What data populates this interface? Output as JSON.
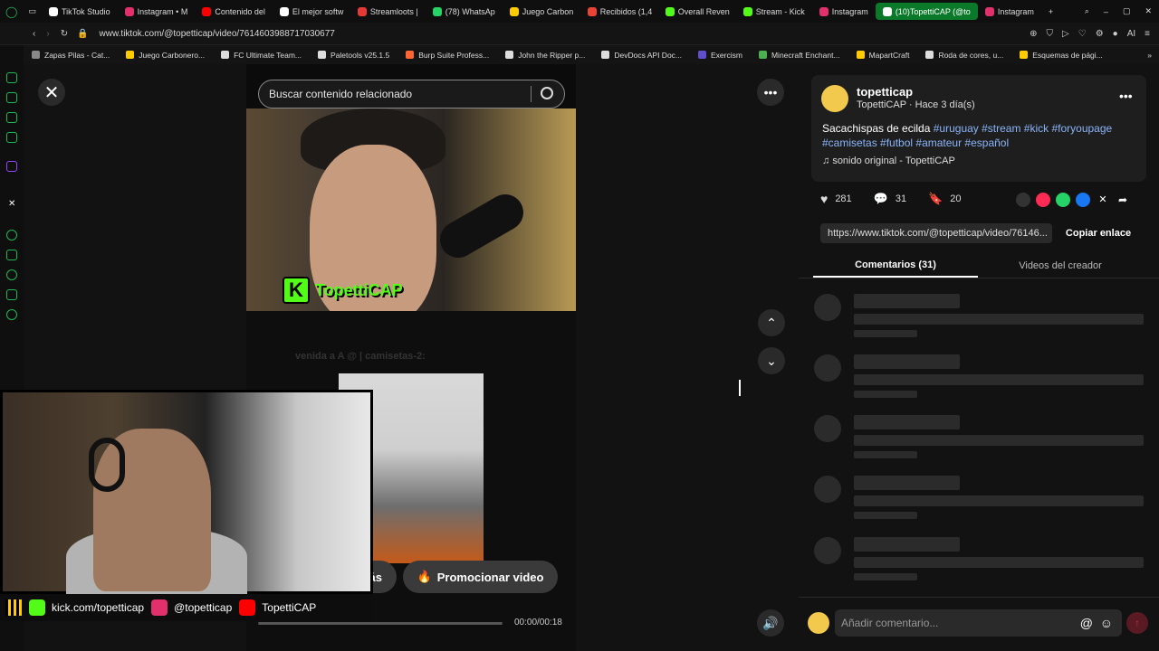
{
  "browser": {
    "tabs": [
      {
        "label": "TikTok Studio",
        "color": "#ffffff"
      },
      {
        "label": "Instagram • M",
        "color": "#e1306c"
      },
      {
        "label": "Contenido del",
        "color": "#ff0000"
      },
      {
        "label": "El mejor softw",
        "color": "#ffffff"
      },
      {
        "label": "Streamloots |",
        "color": "#e53935"
      },
      {
        "label": "(78) WhatsAp",
        "color": "#25d366"
      },
      {
        "label": "Juego Carbon",
        "color": "#ffcc00"
      },
      {
        "label": "Recibidos (1,4",
        "color": "#ea4335"
      },
      {
        "label": "Overall Reven",
        "color": "#53fc18"
      },
      {
        "label": "Stream - Kick",
        "color": "#53fc18"
      },
      {
        "label": "Instagram",
        "color": "#e1306c"
      },
      {
        "label": "(10)TopettiCAP (@to",
        "color": "#ffffff",
        "active": true
      },
      {
        "label": "Instagram",
        "color": "#e1306c"
      }
    ],
    "url": "www.tiktok.com/@topetticap/video/7614603988717030677",
    "ai_label": "AI",
    "bookmarks": [
      {
        "label": "Zapas Pilas - Cat...",
        "color": "#888888"
      },
      {
        "label": "Juego Carbonero...",
        "color": "#ffcc00"
      },
      {
        "label": "FC Ultimate Team...",
        "color": "#dddddd"
      },
      {
        "label": "Paletools v25.1.5",
        "color": "#dddddd"
      },
      {
        "label": "Burp Suite Profess...",
        "color": "#ff6633"
      },
      {
        "label": "John the Ripper p...",
        "color": "#dddddd"
      },
      {
        "label": "DevDocs API Doc...",
        "color": "#dddddd"
      },
      {
        "label": "Exercism",
        "color": "#604fcd"
      },
      {
        "label": "Minecraft Enchant...",
        "color": "#4caf50"
      },
      {
        "label": "MapartCraft",
        "color": "#ffcc00"
      },
      {
        "label": "Roda de cores, u...",
        "color": "#dddddd"
      },
      {
        "label": "Esquemas de pági...",
        "color": "#ffcc00"
      }
    ]
  },
  "video": {
    "search_placeholder": "Buscar contenido relacionado",
    "stream_logo_text": "TopettiCAP",
    "kick_letter": "K",
    "more_button": "más",
    "promote_button": "Promocionar video",
    "time": "00:00/00:18",
    "overlay_caption": "venida a A @ | camisetas-2:"
  },
  "stream_overlay": {
    "socials": [
      {
        "label": "kick.com/topetticap",
        "color": "#53fc18"
      },
      {
        "label": "@topetticap",
        "color": "#e1306c"
      },
      {
        "label": "TopettiCAP",
        "color": "#ff0000"
      }
    ]
  },
  "post": {
    "username": "topetticap",
    "meta": "TopettiCAP · Hace 3 día(s)",
    "desc_text": "Sacachispas de ecilda ",
    "hashtags_line1": "#uruguay #stream #kick #foryoupage",
    "hashtags_line2": "#camisetas #futbol #amateur #español",
    "sound": "sonido original - TopettiCAP",
    "likes": "281",
    "comments": "31",
    "saves": "20",
    "link": "https://www.tiktok.com/@topetticap/video/76146...",
    "copy_link": "Copiar enlace",
    "tab_comments": "Comentarios (31)",
    "tab_creator": "Videos del creador",
    "comment_placeholder": "Añadir comentario..."
  }
}
